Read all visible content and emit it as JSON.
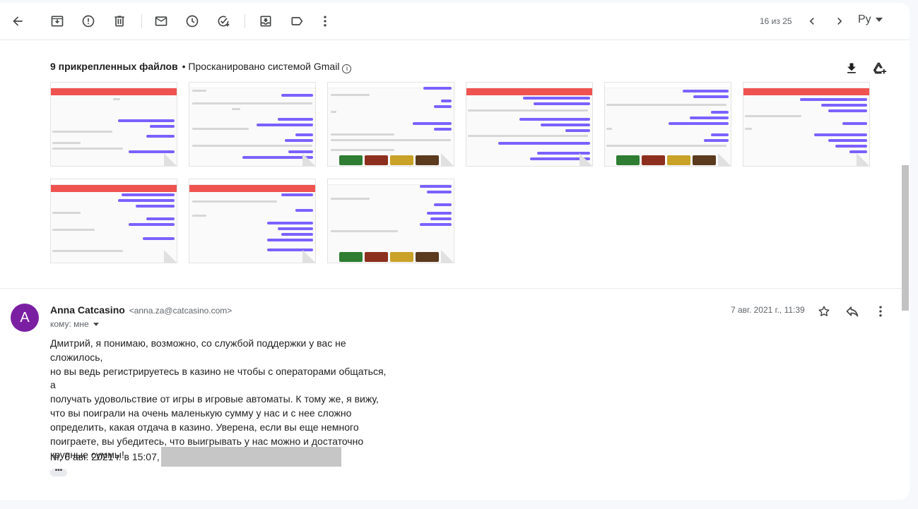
{
  "toolbar": {
    "counter": "16 из 25",
    "language": "Ру",
    "icons": [
      "back-icon",
      "archive-icon",
      "report-spam-icon",
      "delete-icon",
      "mark-unread-icon",
      "snooze-icon",
      "add-task-icon",
      "move-to-icon",
      "label-icon",
      "more-vert-icon",
      "prev-icon",
      "next-icon"
    ]
  },
  "attachments": {
    "count_label": "9 прикрепленных файлов",
    "scanned_label": "• Просканировано системой Gmail",
    "info_glyph": "i",
    "thumbnails": [
      {
        "header": "red",
        "games": false
      },
      {
        "header": "white",
        "games": false
      },
      {
        "header": "white",
        "games": true
      },
      {
        "header": "red",
        "games": false
      },
      {
        "header": "white",
        "games": true
      },
      {
        "header": "red",
        "games": false
      },
      {
        "header": "red",
        "games": false
      },
      {
        "header": "red",
        "games": false
      },
      {
        "header": "white",
        "games": true
      }
    ]
  },
  "message": {
    "avatar_letter": "A",
    "sender_name": "Anna Catcasino",
    "sender_email": "<anna.za@catcasino.com>",
    "to_label": "кому: мне",
    "date": "7 авг. 2021 г., 11:39",
    "body_lines": [
      "Дмитрий, я понимаю, возможно, со службой поддержки у вас не сложилось,",
      "но вы ведь регистрируетесь в казино не чтобы с операторами общаться, а",
      "получать удовольствие от игры в игровые автоматы. К тому же, я вижу,",
      "что вы поиграли на очень маленькую сумму у нас и с нее сложно",
      "определить, какая отдача в казино. Уверена, если вы еще немного",
      "поиграете, вы убедитесь, что выигрывать у нас можно и достаточно",
      "крупные суммы!"
    ],
    "quote_intro": "пт, 6 авг. 2021 г. в 15:07,",
    "more_glyph": "•••"
  },
  "colors": {
    "avatar": "#7b1fa2",
    "thumb_header": "#ef5350",
    "chat_bubble": "#7b61ff"
  }
}
